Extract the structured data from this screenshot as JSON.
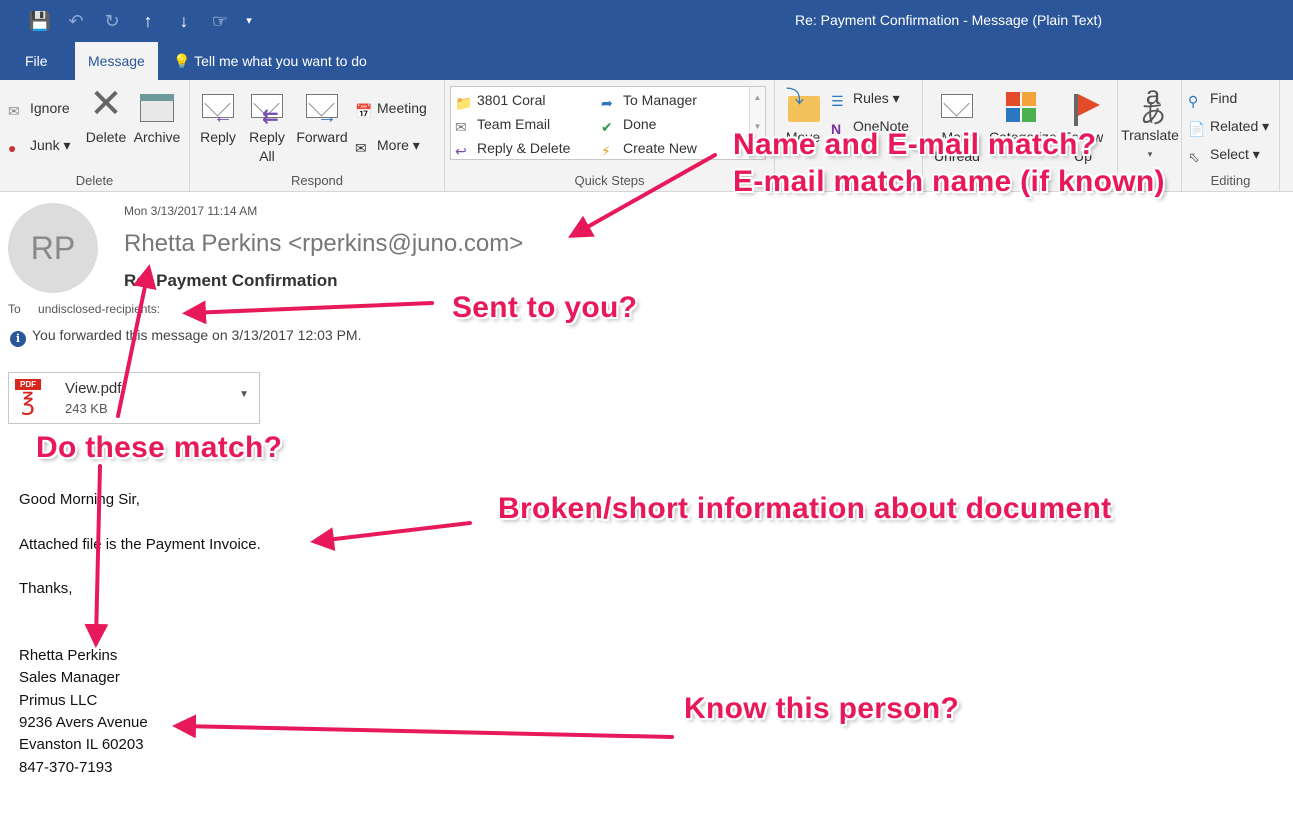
{
  "window": {
    "title": "Re: Payment Confirmation  -  Message (Plain Text)"
  },
  "qat": {
    "icons": [
      "save-icon",
      "undo-icon",
      "redo-icon",
      "up-arrow-icon",
      "down-arrow-icon",
      "touch-mode-icon",
      "customize-dropdown-icon"
    ]
  },
  "tabs": {
    "file": "File",
    "message": "Message",
    "tell_me": "Tell me what you want to do"
  },
  "ribbon": {
    "delete_group": {
      "label": "Delete",
      "ignore": "Ignore",
      "junk": "Junk",
      "delete": "Delete",
      "archive": "Archive"
    },
    "respond_group": {
      "label": "Respond",
      "reply": "Reply",
      "reply_all": "Reply All",
      "forward": "Forward",
      "meeting": "Meeting",
      "more": "More"
    },
    "quick_steps_group": {
      "label": "Quick Steps",
      "items": [
        "3801 Coral",
        "To Manager",
        "Team Email",
        "Done",
        "Reply & Delete",
        "Create New"
      ]
    },
    "move_group": {
      "move": "Move",
      "rules": "Rules",
      "onenote": "OneNote"
    },
    "tags_group": {
      "mark_unread": "Mark Unread",
      "categorize": "Categorize",
      "follow_up": "Follow Up"
    },
    "translate": "Translate",
    "editing_group": {
      "label": "Editing",
      "find": "Find",
      "related": "Related",
      "select": "Select"
    }
  },
  "message": {
    "avatar_initials": "RP",
    "date": "Mon 3/13/2017 11:14 AM",
    "sender": "Rhetta Perkins <rperkins@juno.com>",
    "subject": "Re: Payment Confirmation",
    "to_label": "To",
    "to_value": "undisclosed-recipients:",
    "forward_note": "You forwarded this message on 3/13/2017 12:03 PM.",
    "attachment": {
      "name": "View.pdf",
      "size": "243 KB",
      "badge": "PDF"
    },
    "body": {
      "greeting": "Good Morning Sir,",
      "line1": "Attached file is the Payment Invoice.",
      "closing": "Thanks,",
      "sig_name": "Rhetta Perkins",
      "sig_title": "Sales Manager",
      "sig_company": "Primus LLC",
      "sig_address": "9236 Avers Avenue",
      "sig_city": "Evanston IL 60203",
      "sig_phone": "847-370-7193"
    }
  },
  "annotations": {
    "name_email_1": "Name and E-mail match?",
    "name_email_2": "E-mail match name (if known)",
    "sent_to_you": "Sent to you?",
    "do_these_match": "Do these match?",
    "broken_info": "Broken/short information about document",
    "know_person": "Know this person?"
  },
  "colors": {
    "titlebar": "#2b579a",
    "annotation": "#e8195a"
  }
}
